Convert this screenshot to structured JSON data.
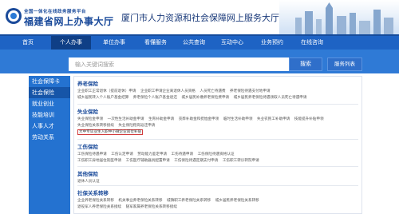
{
  "header": {
    "logo_sub": "全国一体化在线政务服务平台",
    "logo_main": "福建省网上办事大厅",
    "site_title": "厦门市人力资源和社会保障网上服务大厅"
  },
  "nav": {
    "items": [
      {
        "label": "首页"
      },
      {
        "label": "个人办事"
      },
      {
        "label": "单位办事"
      },
      {
        "label": "看懂服务"
      },
      {
        "label": "公共查询"
      },
      {
        "label": "互动中心"
      },
      {
        "label": "业务预约"
      },
      {
        "label": "在线咨询"
      }
    ],
    "active_index": 1
  },
  "search": {
    "placeholder": "输入关键词搜索",
    "search_label": "搜索",
    "service_list_label": "服务列表"
  },
  "sidebar": {
    "items": [
      {
        "label": "社会保障卡"
      },
      {
        "label": "社会保险"
      },
      {
        "label": "就业创业"
      },
      {
        "label": "技能培训"
      },
      {
        "label": "人事人才"
      },
      {
        "label": "劳动关系"
      }
    ],
    "active_index": 1
  },
  "content": {
    "sections": [
      {
        "title": "养老保险",
        "lines": [
          [
            "企业职工正常退休（提前退休）申请",
            "企业职工申请企业离退休人员资格",
            "人员死亡待遇费",
            "养老保险待遇支付地申请"
          ],
          [
            "城乡居民转入个人账户基金结算",
            "养老保险个人账户基金退还",
            "城乡居民补缴养老保险费申请",
            "城乡居民养老保险待遇领取人员死亡待遇申请"
          ]
        ]
      },
      {
        "title": "失业保险",
        "lines": [
          [
            "失业保险金申领",
            "一次性生活补助金申请",
            "生育补助金申请",
            "丧葬补助金和抚恤金申领",
            "临时生活补助申领",
            "失业农民工补助申请",
            "技能提升补贴申领"
          ],
          [
            "失业保险关系转移接续",
            "失业保险稳岗返还申请",
            "大中专毕业生入职中小微企业岗位补贴"
          ]
        ],
        "highlight": "大中专毕业生入职中小微企业岗位补贴"
      },
      {
        "title": "工伤保险",
        "lines": [
          [
            "工伤保险待遇申请",
            "工伤认定申请",
            "劳动能力鉴定申请",
            "工伤待遇申请",
            "工伤保险待遇资格认证"
          ],
          [
            "工伤职工异地居住就医申请",
            "工伤医疗辅助器具配置申请",
            "工伤保险待遇定期支付申请",
            "工伤职工转诊转院申请"
          ]
        ]
      },
      {
        "title": "其他保险",
        "lines": [
          [
            "退休人员认证"
          ]
        ]
      },
      {
        "title": "社保关系转移",
        "lines": [
          [
            "企业养老保险关系转移",
            "机关事业养老保险关系转移",
            "城镇职工养老保险关系转移",
            "城乡居民养老保险关系转移"
          ],
          [
            "退役军人养老保险关系接续",
            "随军家属养老保险关系转移接续"
          ]
        ]
      }
    ]
  }
}
